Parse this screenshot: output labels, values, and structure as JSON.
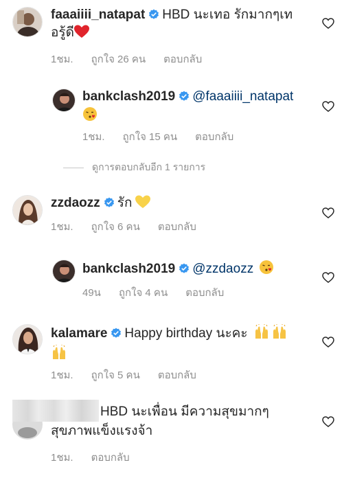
{
  "comments": [
    {
      "username": "faaaiiii_natapat",
      "verified": true,
      "text_line1": "HBD นะเทอ รักมากๆเท",
      "text_line2": "อรู้ดี",
      "time": "1ชม.",
      "likes": "ถูกใจ 26 คน",
      "reply": "ตอบกลับ"
    },
    {
      "username": "bankclash2019",
      "verified": true,
      "mention": "@faaaiiii_natapat",
      "time": "1ชม.",
      "likes": "ถูกใจ 15 คน",
      "reply": "ตอบกลับ"
    },
    {
      "username": "zzdaozz",
      "verified": true,
      "text_line1": "รัก",
      "time": "1ชม.",
      "likes": "ถูกใจ 6 คน",
      "reply": "ตอบกลับ"
    },
    {
      "username": "bankclash2019",
      "verified": true,
      "mention": "@zzdaozz",
      "time": "49น",
      "likes": "ถูกใจ 4 คน",
      "reply": "ตอบกลับ"
    },
    {
      "username": "kalamare",
      "verified": true,
      "text_line1": "Happy birthday นะคะ",
      "time": "1ชม.",
      "likes": "ถูกใจ 5 คน",
      "reply": "ตอบกลับ"
    },
    {
      "text_line1": "HBD นะเพื่อน มีความสุขมากๆ",
      "text_line2": "สุขภาพแข็งแรงจ้า",
      "time": "1ชม.",
      "reply": "ตอบกลับ"
    }
  ],
  "view_more_replies": "ดูการตอบกลับอีก 1 รายการ",
  "colors": {
    "verified": "#3897f0",
    "meta": "#8e8e8e",
    "mention": "#003569",
    "heart_outline": "#262626"
  }
}
